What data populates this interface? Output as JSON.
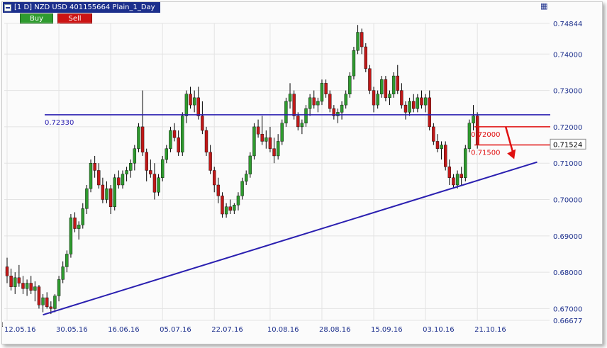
{
  "window": {
    "title": "[1 D] NZD USD   401155664 Plain_1_Day",
    "buy_label": "Buy",
    "sell_label": "Sell",
    "grid_icon": "grid-icon",
    "menu_icon": "window-menu-icon"
  },
  "colors": {
    "up": "#2e9a2e",
    "down": "#c01818",
    "wick": "#000000",
    "trendline": "#2a1fb0",
    "resistance": "#2a1fb0",
    "annotation": "#e01010",
    "axis_text": "#1c2f8c",
    "grid": "#e3e3e3"
  },
  "chart_data": {
    "type": "candlestick",
    "title": "",
    "xlabel": "",
    "ylabel": "",
    "ylim": [
      0.66677,
      0.74844
    ],
    "grid": true,
    "y_ticks": [
      "0.74844",
      "0.74000",
      "0.73000",
      "0.72000",
      "0.71000",
      "0.70000",
      "0.69000",
      "0.68000",
      "0.67000",
      "0.66677"
    ],
    "x_ticks": [
      {
        "label": "12.05.16",
        "index": 0
      },
      {
        "label": "30.05.16",
        "index": 13
      },
      {
        "label": "16.06.16",
        "index": 26
      },
      {
        "label": "05.07.16",
        "index": 39
      },
      {
        "label": "22.07.16",
        "index": 52
      },
      {
        "label": "10.08.16",
        "index": 66
      },
      {
        "label": "28.08.16",
        "index": 79
      },
      {
        "label": "15.09.16",
        "index": 92
      },
      {
        "label": "03.10.16",
        "index": 105
      },
      {
        "label": "21.10.16",
        "index": 118
      }
    ],
    "current_price": "0.71524",
    "lines": [
      {
        "type": "horizontal",
        "label": "0.72330",
        "value": 0.7233
      },
      {
        "type": "trend",
        "from": {
          "index": 9,
          "value": 0.6683
        },
        "to": {
          "index": 133,
          "value": 0.7103
        }
      }
    ],
    "annotations": [
      {
        "label": "0.72000",
        "value": 0.72
      },
      {
        "label": "0.71500",
        "value": 0.715
      }
    ],
    "candles": [
      [
        0.6815,
        0.684,
        0.677,
        0.679
      ],
      [
        0.679,
        0.681,
        0.675,
        0.676
      ],
      [
        0.676,
        0.68,
        0.674,
        0.6785
      ],
      [
        0.6785,
        0.682,
        0.676,
        0.677
      ],
      [
        0.677,
        0.679,
        0.674,
        0.6755
      ],
      [
        0.6755,
        0.678,
        0.6735,
        0.677
      ],
      [
        0.677,
        0.679,
        0.674,
        0.675
      ],
      [
        0.675,
        0.6775,
        0.672,
        0.676
      ],
      [
        0.676,
        0.6765,
        0.67,
        0.671
      ],
      [
        0.671,
        0.674,
        0.669,
        0.673
      ],
      [
        0.673,
        0.6745,
        0.67,
        0.6705
      ],
      [
        0.6705,
        0.672,
        0.6685,
        0.67
      ],
      [
        0.67,
        0.674,
        0.669,
        0.6735
      ],
      [
        0.6735,
        0.679,
        0.672,
        0.678
      ],
      [
        0.678,
        0.683,
        0.677,
        0.6815
      ],
      [
        0.6815,
        0.686,
        0.68,
        0.685
      ],
      [
        0.685,
        0.696,
        0.684,
        0.695
      ],
      [
        0.695,
        0.6965,
        0.691,
        0.692
      ],
      [
        0.692,
        0.694,
        0.689,
        0.693
      ],
      [
        0.693,
        0.699,
        0.692,
        0.6975
      ],
      [
        0.6975,
        0.704,
        0.696,
        0.703
      ],
      [
        0.703,
        0.711,
        0.702,
        0.71
      ],
      [
        0.71,
        0.712,
        0.706,
        0.708
      ],
      [
        0.708,
        0.71,
        0.703,
        0.704
      ],
      [
        0.704,
        0.706,
        0.699,
        0.7
      ],
      [
        0.7,
        0.705,
        0.699,
        0.703
      ],
      [
        0.703,
        0.704,
        0.696,
        0.698
      ],
      [
        0.698,
        0.707,
        0.697,
        0.706
      ],
      [
        0.706,
        0.708,
        0.703,
        0.704
      ],
      [
        0.704,
        0.708,
        0.703,
        0.707
      ],
      [
        0.707,
        0.709,
        0.705,
        0.708
      ],
      [
        0.708,
        0.711,
        0.706,
        0.71
      ],
      [
        0.71,
        0.715,
        0.708,
        0.714
      ],
      [
        0.714,
        0.721,
        0.713,
        0.72
      ],
      [
        0.72,
        0.73,
        0.712,
        0.713
      ],
      [
        0.713,
        0.714,
        0.705,
        0.708
      ],
      [
        0.708,
        0.711,
        0.706,
        0.707
      ],
      [
        0.707,
        0.71,
        0.7,
        0.702
      ],
      [
        0.702,
        0.707,
        0.701,
        0.706
      ],
      [
        0.706,
        0.712,
        0.705,
        0.711
      ],
      [
        0.711,
        0.715,
        0.71,
        0.714
      ],
      [
        0.714,
        0.72,
        0.713,
        0.719
      ],
      [
        0.719,
        0.721,
        0.716,
        0.717
      ],
      [
        0.717,
        0.719,
        0.712,
        0.713
      ],
      [
        0.713,
        0.724,
        0.712,
        0.723
      ],
      [
        0.723,
        0.73,
        0.721,
        0.729
      ],
      [
        0.729,
        0.731,
        0.725,
        0.726
      ],
      [
        0.726,
        0.73,
        0.724,
        0.728
      ],
      [
        0.728,
        0.731,
        0.722,
        0.723
      ],
      [
        0.723,
        0.727,
        0.718,
        0.719
      ],
      [
        0.719,
        0.72,
        0.712,
        0.713
      ],
      [
        0.713,
        0.715,
        0.707,
        0.708
      ],
      [
        0.708,
        0.709,
        0.702,
        0.704
      ],
      [
        0.704,
        0.706,
        0.699,
        0.701
      ],
      [
        0.701,
        0.702,
        0.695,
        0.696
      ],
      [
        0.696,
        0.699,
        0.695,
        0.698
      ],
      [
        0.698,
        0.7,
        0.696,
        0.697
      ],
      [
        0.697,
        0.699,
        0.696,
        0.6985
      ],
      [
        0.6985,
        0.702,
        0.697,
        0.701
      ],
      [
        0.701,
        0.706,
        0.7,
        0.705
      ],
      [
        0.705,
        0.708,
        0.704,
        0.707
      ],
      [
        0.707,
        0.713,
        0.706,
        0.712
      ],
      [
        0.712,
        0.721,
        0.711,
        0.72
      ],
      [
        0.72,
        0.722,
        0.717,
        0.718
      ],
      [
        0.718,
        0.723,
        0.715,
        0.716
      ],
      [
        0.716,
        0.719,
        0.714,
        0.717
      ],
      [
        0.717,
        0.72,
        0.713,
        0.714
      ],
      [
        0.714,
        0.717,
        0.71,
        0.712
      ],
      [
        0.712,
        0.718,
        0.711,
        0.716
      ],
      [
        0.716,
        0.722,
        0.715,
        0.721
      ],
      [
        0.721,
        0.728,
        0.72,
        0.727
      ],
      [
        0.727,
        0.732,
        0.725,
        0.729
      ],
      [
        0.729,
        0.73,
        0.722,
        0.723
      ],
      [
        0.723,
        0.724,
        0.719,
        0.72
      ],
      [
        0.72,
        0.722,
        0.718,
        0.721
      ],
      [
        0.721,
        0.726,
        0.72,
        0.725
      ],
      [
        0.725,
        0.729,
        0.723,
        0.728
      ],
      [
        0.728,
        0.73,
        0.725,
        0.726
      ],
      [
        0.726,
        0.728,
        0.724,
        0.727
      ],
      [
        0.727,
        0.733,
        0.726,
        0.732
      ],
      [
        0.732,
        0.733,
        0.728,
        0.729
      ],
      [
        0.729,
        0.73,
        0.724,
        0.725
      ],
      [
        0.725,
        0.726,
        0.722,
        0.723
      ],
      [
        0.723,
        0.725,
        0.721,
        0.724
      ],
      [
        0.724,
        0.727,
        0.722,
        0.726
      ],
      [
        0.726,
        0.73,
        0.725,
        0.729
      ],
      [
        0.729,
        0.735,
        0.728,
        0.734
      ],
      [
        0.734,
        0.742,
        0.733,
        0.741
      ],
      [
        0.741,
        0.748,
        0.74,
        0.746
      ],
      [
        0.746,
        0.747,
        0.74,
        0.742
      ],
      [
        0.742,
        0.743,
        0.735,
        0.736
      ],
      [
        0.736,
        0.737,
        0.729,
        0.73
      ],
      [
        0.73,
        0.731,
        0.724,
        0.726
      ],
      [
        0.726,
        0.73,
        0.725,
        0.729
      ],
      [
        0.729,
        0.734,
        0.728,
        0.733
      ],
      [
        0.733,
        0.734,
        0.727,
        0.728
      ],
      [
        0.728,
        0.73,
        0.726,
        0.729
      ],
      [
        0.729,
        0.735,
        0.728,
        0.734
      ],
      [
        0.734,
        0.737,
        0.729,
        0.73
      ],
      [
        0.73,
        0.732,
        0.725,
        0.726
      ],
      [
        0.726,
        0.727,
        0.722,
        0.724
      ],
      [
        0.724,
        0.728,
        0.723,
        0.727
      ],
      [
        0.727,
        0.729,
        0.724,
        0.725
      ],
      [
        0.725,
        0.729,
        0.724,
        0.728
      ],
      [
        0.728,
        0.73,
        0.725,
        0.726
      ],
      [
        0.726,
        0.729,
        0.724,
        0.728
      ],
      [
        0.728,
        0.73,
        0.719,
        0.72
      ],
      [
        0.72,
        0.721,
        0.715,
        0.716
      ],
      [
        0.716,
        0.718,
        0.713,
        0.714
      ],
      [
        0.714,
        0.716,
        0.711,
        0.715
      ],
      [
        0.715,
        0.716,
        0.708,
        0.709
      ],
      [
        0.709,
        0.711,
        0.704,
        0.706
      ],
      [
        0.706,
        0.707,
        0.703,
        0.704
      ],
      [
        0.704,
        0.708,
        0.703,
        0.707
      ],
      [
        0.707,
        0.709,
        0.704,
        0.706
      ],
      [
        0.706,
        0.715,
        0.705,
        0.714
      ],
      [
        0.714,
        0.722,
        0.713,
        0.721
      ],
      [
        0.721,
        0.726,
        0.719,
        0.723
      ],
      [
        0.723,
        0.724,
        0.714,
        0.7152
      ]
    ]
  }
}
